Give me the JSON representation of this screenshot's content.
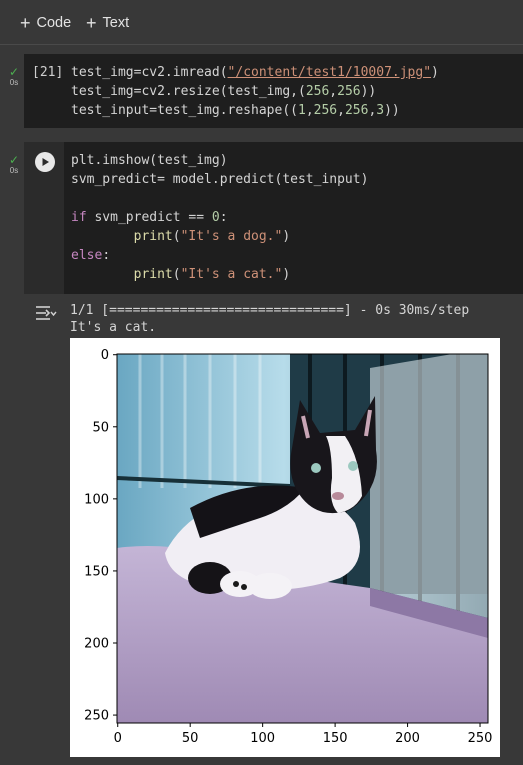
{
  "toolbar": {
    "add_code": "Code",
    "add_text": "Text"
  },
  "cell1": {
    "status_time": "0s",
    "exec_count": "[21]",
    "lines": [
      [
        "test_img=cv2.imread(",
        "\"/content/test1/10007.jpg\"",
        ")"
      ],
      [
        "test_img=cv2.resize(test_img,(",
        "256",
        ",",
        "256",
        "))"
      ],
      [
        "test_input=test_img.reshape((",
        "1",
        ",",
        "256",
        ",",
        "256",
        ",",
        "3",
        "))"
      ]
    ]
  },
  "cell2": {
    "status_time": "0s",
    "code": {
      "l1": "plt.imshow(test_img)",
      "l2": "svm_predict= model.predict(test_input)",
      "if_kw": "if",
      "if_rest": " svm_predict == ",
      "zero": "0",
      "colon": ":",
      "print1_fn": "print",
      "print1_str": "\"It's a dog.\"",
      "else_kw": "else",
      "print2_fn": "print",
      "print2_str": "\"It's a cat.\""
    },
    "output": {
      "progress": "1/1 [==============================] - 0s 30ms/step",
      "result": "It's a cat."
    }
  },
  "plot": {
    "y_ticks": [
      "0",
      "50",
      "100",
      "150",
      "200",
      "250"
    ],
    "x_ticks": [
      "0",
      "50",
      "100",
      "150",
      "200",
      "250"
    ],
    "image_colors": {
      "cage_top": "#a9d6e6",
      "blanket": "#b7a3c8",
      "fur_white": "#f3f1f6",
      "fur_black": "#121015"
    }
  }
}
